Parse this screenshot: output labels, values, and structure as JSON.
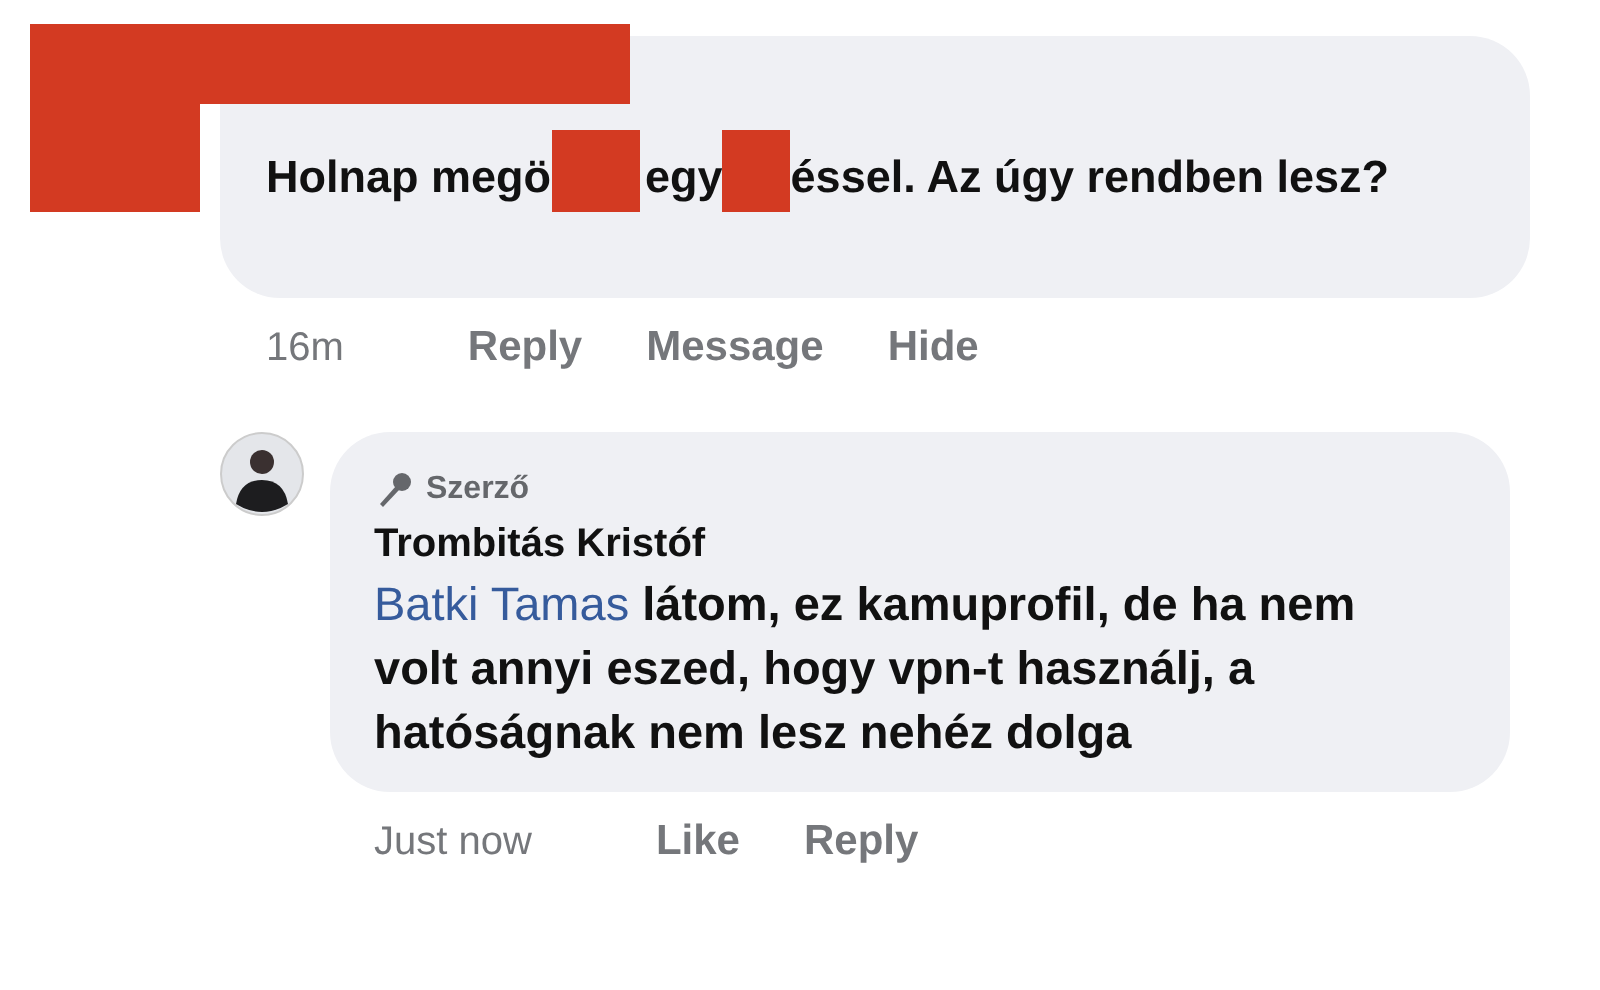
{
  "comment": {
    "author_redacted": true,
    "parts": [
      {
        "kind": "text",
        "text": "Holnap megö"
      },
      {
        "kind": "redaction"
      },
      {
        "kind": "text",
        "text": "egy"
      },
      {
        "kind": "redaction"
      },
      {
        "kind": "text",
        "text": "éssel. Az úgy rendben lesz?"
      }
    ],
    "time": "16m",
    "actions": [
      "Reply",
      "Message",
      "Hide"
    ]
  },
  "reply": {
    "badge": "Szerző",
    "author": "Trombitás Kristóf",
    "mention": "Batki Tamas",
    "text": " látom, ez kamuprofil, de ha nem volt annyi eszed, hogy vpn-t használj, a hatóságnak nem lesz nehéz dolga",
    "time": "Just now",
    "actions": [
      "Like",
      "Reply"
    ]
  }
}
